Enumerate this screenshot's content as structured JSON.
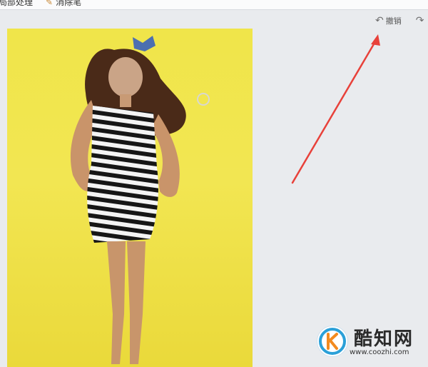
{
  "toolbar": {
    "item1_label": "局部处理",
    "item2_label": "消除笔",
    "pencil_icon": "pencil-icon"
  },
  "undo": {
    "undo_label": "撤销",
    "undo_icon": "undo-arrow-icon",
    "redo_icon": "redo-arrow-icon"
  },
  "watermark": {
    "name": "酷知网",
    "url": "www.coozhi.com"
  },
  "colors": {
    "background": "#e9ebee",
    "photo_yellow": "#f0e54a",
    "arrow_red": "#e8413a"
  }
}
